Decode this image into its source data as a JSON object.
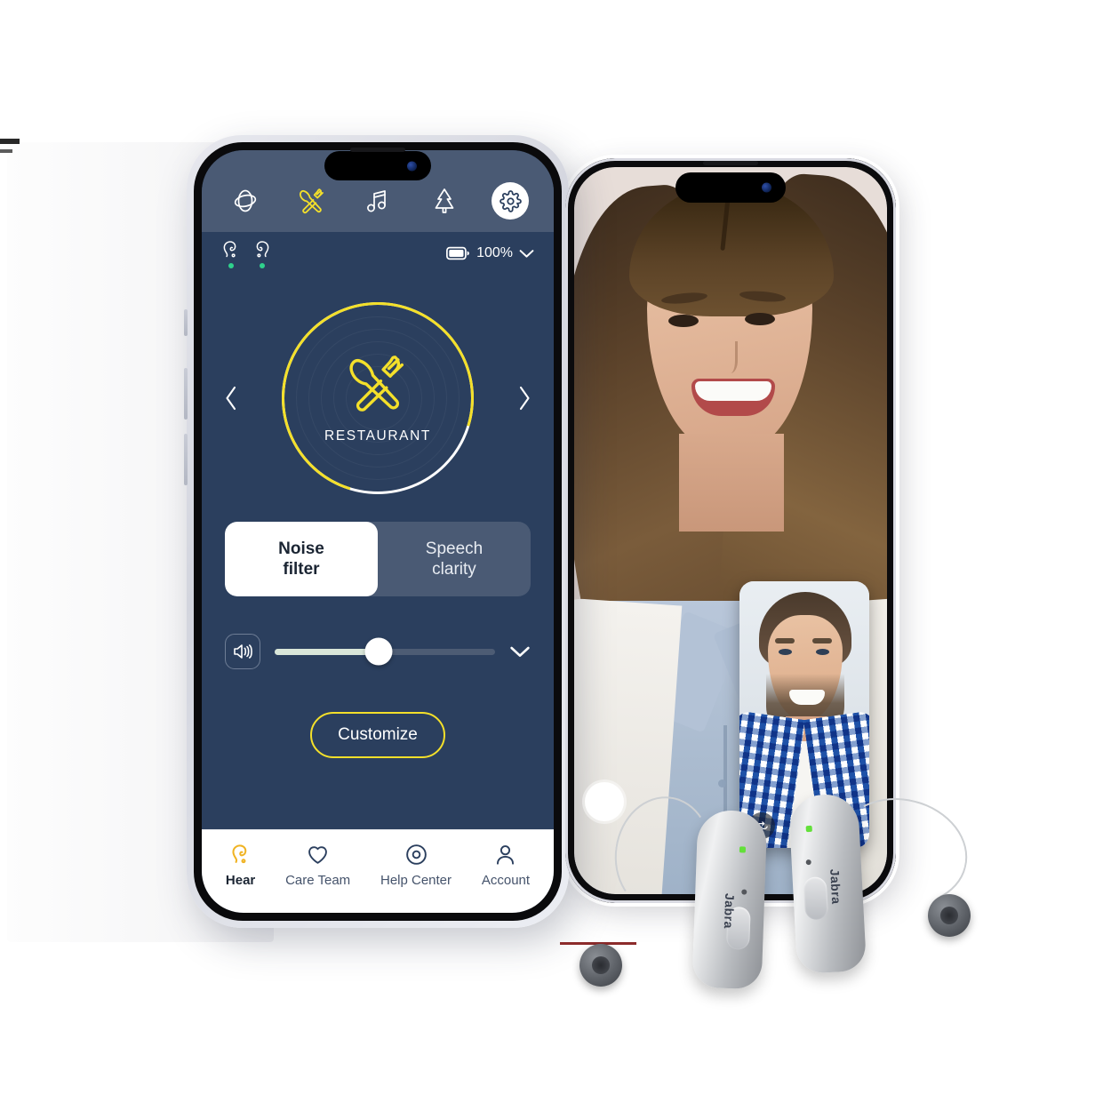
{
  "app": {
    "name": "Hearing aid companion app",
    "colors": {
      "screen_bg": "#2b3f5e",
      "topbar_bg": "#4a5a74",
      "accent_yellow": "#f4e02a",
      "status_green": "#2fd18c",
      "nav_bg": "#ffffff",
      "active_text": "#1b2533"
    }
  },
  "program_bar": {
    "programs": [
      {
        "id": "all-around",
        "icon": "all-around-sphere-icon",
        "label": "All-around",
        "active": false
      },
      {
        "id": "restaurant",
        "icon": "restaurant-cutlery-icon",
        "label": "Restaurant",
        "active": true
      },
      {
        "id": "music",
        "icon": "music-note-icon",
        "label": "Music",
        "active": false
      },
      {
        "id": "outdoor",
        "icon": "pine-tree-icon",
        "label": "Outdoor",
        "active": false
      }
    ],
    "settings": {
      "icon": "gear-icon",
      "label": "Settings"
    }
  },
  "status_bar": {
    "left_aid": {
      "icon": "hearing-aid-icon",
      "label": "Left hearing aid",
      "connected": true
    },
    "right_aid": {
      "icon": "hearing-aid-icon",
      "label": "Right hearing aid",
      "connected": true
    },
    "battery": {
      "icon": "battery-full-icon",
      "level": "100%",
      "chevron": "chevron-down-icon"
    }
  },
  "program_dial": {
    "prev_label": "‹",
    "next_label": "›",
    "current_program": "RESTAURANT",
    "icon": "restaurant-cutlery-icon"
  },
  "segmented_control": {
    "options": [
      {
        "id": "noise-filter",
        "line1": "Noise",
        "line2": "filter",
        "active": true
      },
      {
        "id": "speech-clarity",
        "line1": "Speech",
        "line2": "clarity",
        "active": false
      }
    ]
  },
  "volume": {
    "icon": "speaker-volume-icon",
    "value_percent": 47,
    "expand_icon": "chevron-down-icon"
  },
  "customize_button": {
    "label": "Customize"
  },
  "bottom_nav": {
    "items": [
      {
        "id": "hear",
        "label": "Hear",
        "icon": "hearing-aid-icon",
        "active": true
      },
      {
        "id": "care-team",
        "label": "Care Team",
        "icon": "heart-icon",
        "active": false
      },
      {
        "id": "help-center",
        "label": "Help Center",
        "icon": "life-ring-icon",
        "active": false
      },
      {
        "id": "account",
        "label": "Account",
        "icon": "person-icon",
        "active": false
      }
    ]
  },
  "video_call": {
    "main_participant": "Woman on video call",
    "pip_participant": "Man on video call",
    "flip_camera_icon": "flip-camera-icon",
    "end_call_button": "end-call-button"
  },
  "hearing_aids": {
    "brand": "Jabra",
    "count": 2,
    "left_label": "Jabra",
    "right_label": "Jabra"
  }
}
